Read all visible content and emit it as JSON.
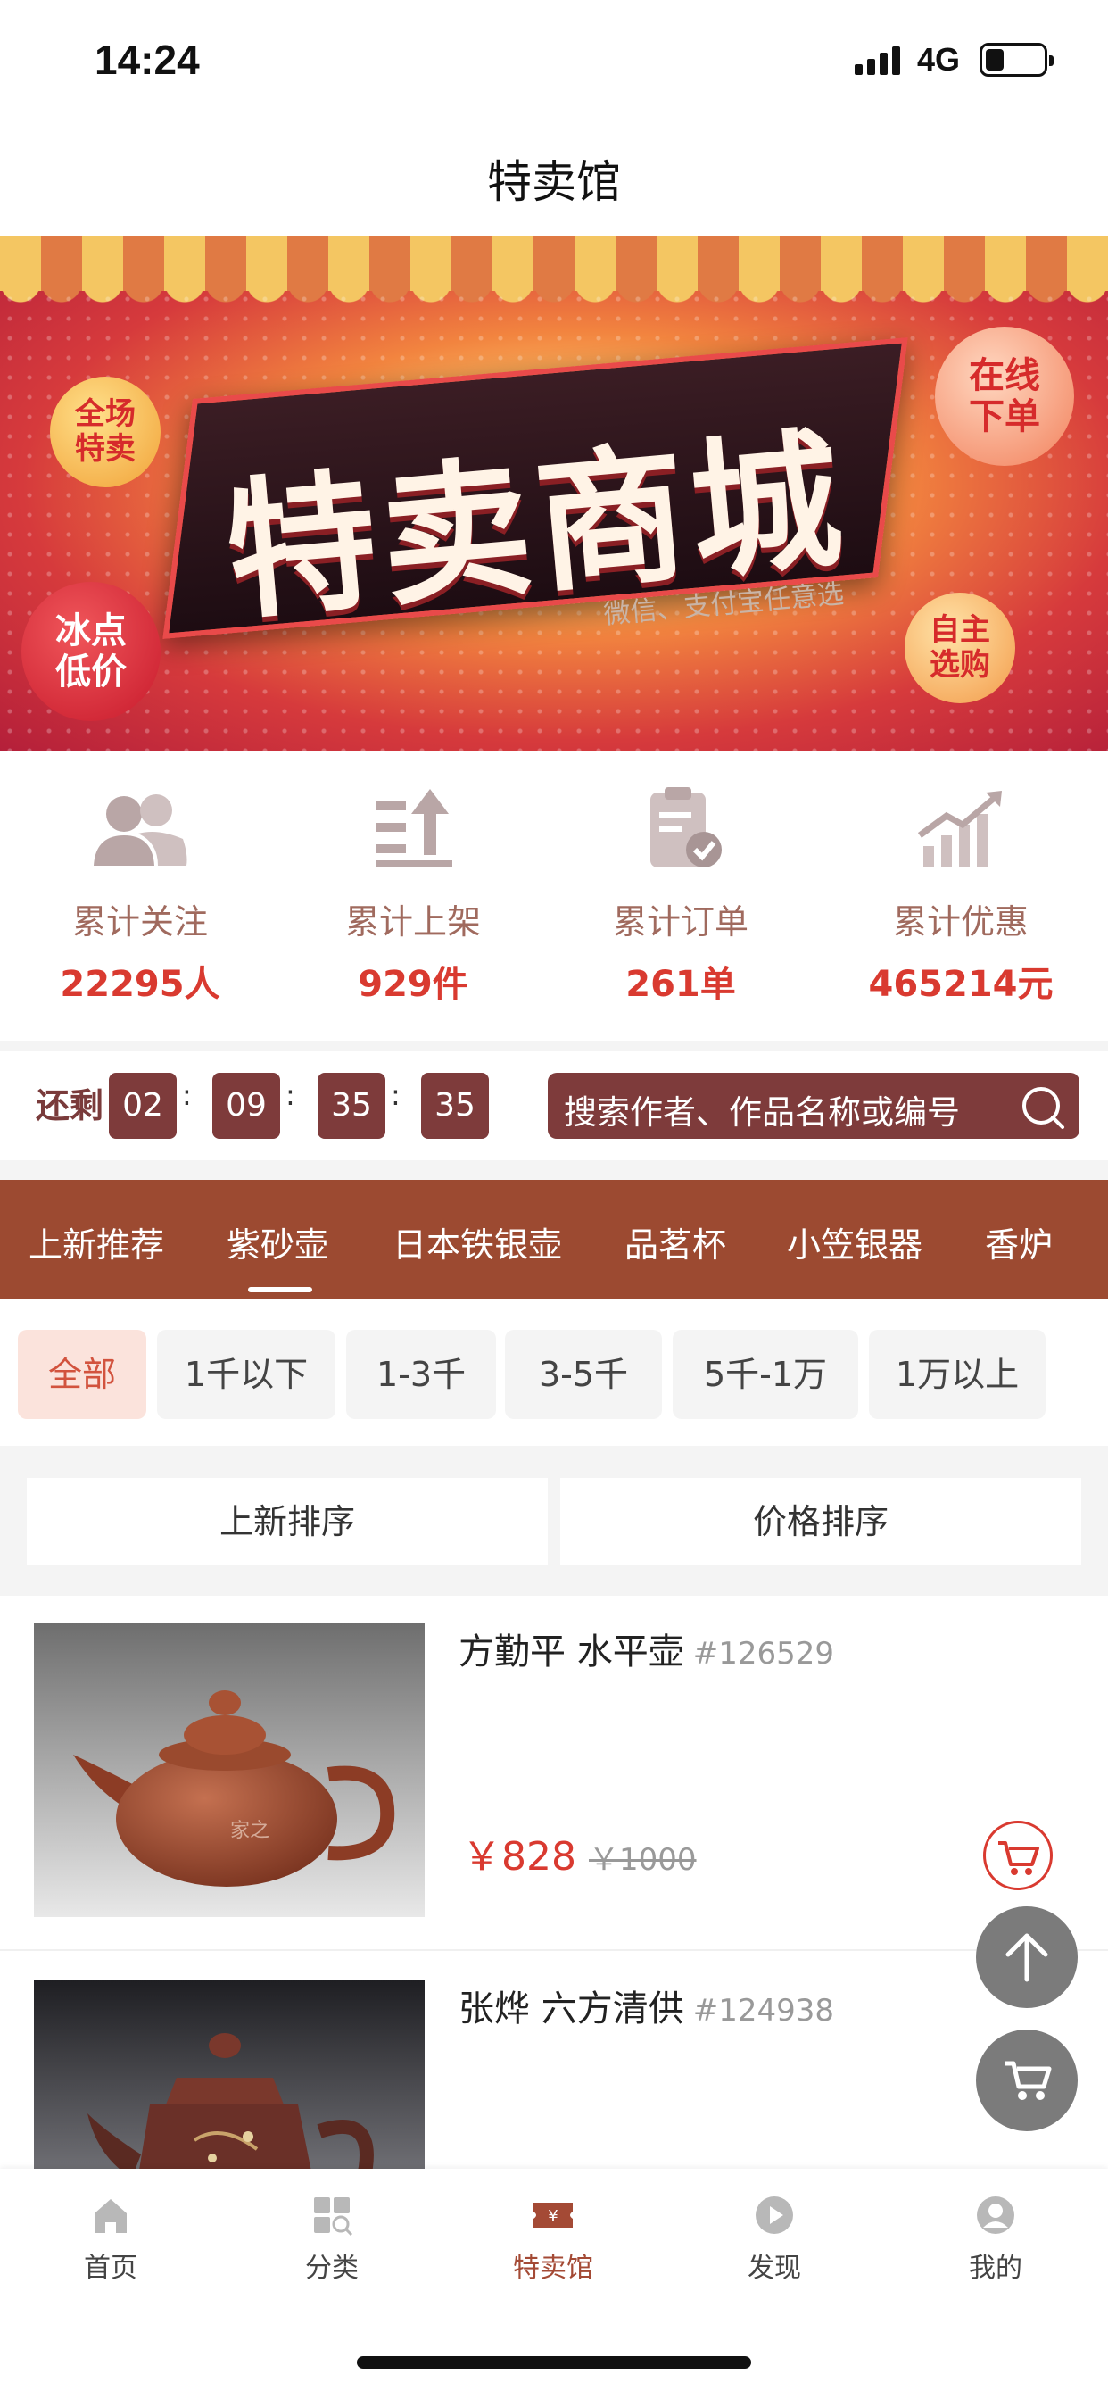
{
  "status_bar": {
    "time": "14:24",
    "network": "4G"
  },
  "header": {
    "title": "特卖馆"
  },
  "banner": {
    "title": "特卖商城",
    "subtitle": "微信、支付宝任意选",
    "badges": [
      "全场\n特卖",
      "冰点\n低价",
      "在线\n下单",
      "自主\n选购"
    ]
  },
  "stats": [
    {
      "label": "累计关注",
      "value": "22295人",
      "icon": "users-icon"
    },
    {
      "label": "累计上架",
      "value": "929件",
      "icon": "shelf-up-icon"
    },
    {
      "label": "累计订单",
      "value": "261单",
      "icon": "clipboard-check-icon"
    },
    {
      "label": "累计优惠",
      "value": "465214元",
      "icon": "growth-chart-icon"
    }
  ],
  "countdown": {
    "label": "还剩",
    "days": "02",
    "hours": "09",
    "minutes": "35",
    "seconds": "35",
    "separator": ":"
  },
  "search": {
    "placeholder": "搜索作者、作品名称或编号"
  },
  "category_tabs": [
    "上新推荐",
    "紫砂壶",
    "日本铁银壶",
    "品茗杯",
    "小笠银器",
    "香炉"
  ],
  "active_category": "紫砂壶",
  "price_filters": [
    "全部",
    "1千以下",
    "1-3千",
    "3-5千",
    "5千-1万",
    "1万以上"
  ],
  "active_price_filter": "全部",
  "sort": {
    "new": "上新排序",
    "price": "价格排序"
  },
  "products": [
    {
      "name": "方勤平 水平壶",
      "id": "#126529",
      "price": "￥828",
      "original_price": "￥1000",
      "watermark": "家之"
    },
    {
      "name": "张烨 六方清供",
      "id": "#124938"
    }
  ],
  "tab_bar": [
    {
      "label": "首页",
      "icon": "home-icon"
    },
    {
      "label": "分类",
      "icon": "category-icon"
    },
    {
      "label": "特卖馆",
      "icon": "ticket-yen-icon"
    },
    {
      "label": "发现",
      "icon": "play-icon"
    },
    {
      "label": "我的",
      "icon": "profile-icon"
    }
  ],
  "active_tab": "特卖馆",
  "colors": {
    "accent": "#9c4a31",
    "dark_brown": "#7e3b3b",
    "price_red": "#d93a30",
    "active_tab_text": "#a44a35"
  }
}
